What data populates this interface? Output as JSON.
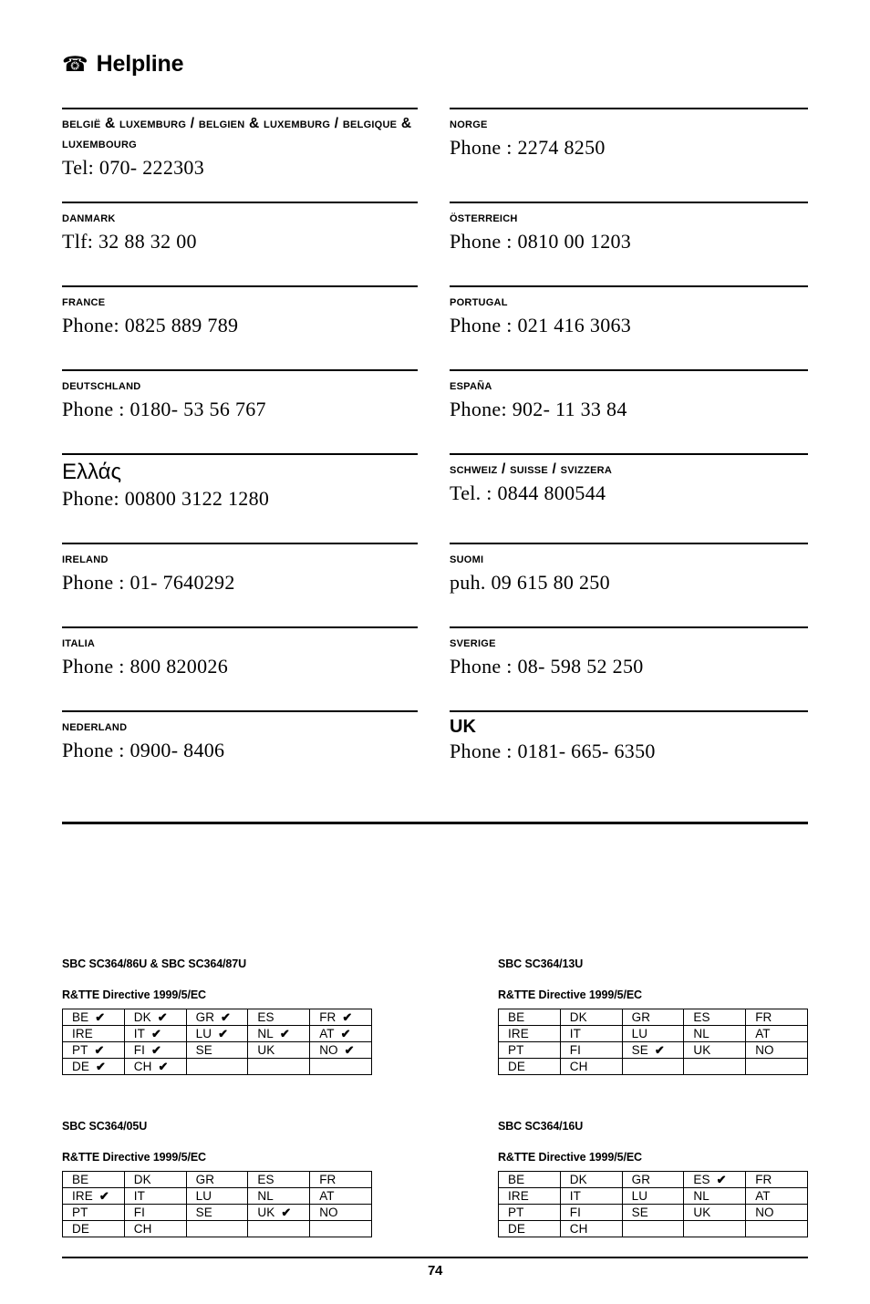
{
  "header": {
    "icon": "telephone-icon",
    "glyph": "☎",
    "title": "Helpline"
  },
  "helpline": {
    "left_column": [
      {
        "country": "België & Luxemburg / Belgien & Luxemburg / Belgique & Luxembourg",
        "phone": "Tel: 070- 222303",
        "style": "smallcaps"
      },
      {
        "country": "Danmark",
        "phone": "Tlf: 32 88 32 00",
        "style": "smallcaps"
      },
      {
        "country": "France",
        "phone": "Phone: 0825 889 789",
        "style": "smallcaps"
      },
      {
        "country": "Deutschland",
        "phone": "Phone : 0180- 53 56 767",
        "style": "smallcaps"
      },
      {
        "country": "Ελλάς",
        "phone": "Phone: 00800 3122 1280",
        "style": "greek"
      },
      {
        "country": "Ireland",
        "phone": "Phone : 01- 7640292",
        "style": "smallcaps"
      },
      {
        "country": "Italia",
        "phone": "Phone : 800 820026",
        "style": "smallcaps"
      },
      {
        "country": "Nederland",
        "phone": "Phone : 0900- 8406",
        "style": "smallcaps"
      }
    ],
    "right_column": [
      {
        "country": "Norge",
        "phone": "Phone : 2274 8250",
        "style": "smallcaps"
      },
      {
        "country": "Österreich",
        "phone": "Phone : 0810 00 1203",
        "style": "smallcaps"
      },
      {
        "country": "Portugal",
        "phone": "Phone : 021 416 3063",
        "style": "smallcaps"
      },
      {
        "country": "España",
        "phone": "Phone: 902- 11 33 84",
        "style": "smallcaps"
      },
      {
        "country": "Schweiz  / Suisse  / Svizzera",
        "phone": "Tel. : 0844 800544",
        "style": "smallcaps"
      },
      {
        "country": "Suomi",
        "phone": "puh. 09 615 80 250",
        "style": "smallcaps"
      },
      {
        "country": "Sverige",
        "phone": "Phone : 08- 598 52 250",
        "style": "smallcaps"
      },
      {
        "country": "UK",
        "phone": "Phone : 0181- 665- 6350",
        "style": "plain"
      }
    ]
  },
  "certifications": {
    "check_mark": "✔",
    "blocks": [
      {
        "model": "SBC SC364/86U & SBC SC364/87U",
        "directive": "R&TTE Directive  1999/5/EC",
        "rows": [
          [
            {
              "code": "BE",
              "checked": true
            },
            {
              "code": "DK",
              "checked": true
            },
            {
              "code": "GR",
              "checked": true
            },
            {
              "code": "ES",
              "checked": false
            },
            {
              "code": "FR",
              "checked": true
            }
          ],
          [
            {
              "code": "IRE",
              "checked": false
            },
            {
              "code": "IT",
              "checked": true
            },
            {
              "code": "LU",
              "checked": true
            },
            {
              "code": "NL",
              "checked": true
            },
            {
              "code": "AT",
              "checked": true
            }
          ],
          [
            {
              "code": "PT",
              "checked": true
            },
            {
              "code": "FI",
              "checked": true
            },
            {
              "code": "SE",
              "checked": false
            },
            {
              "code": "UK",
              "checked": false
            },
            {
              "code": "NO",
              "checked": true
            }
          ],
          [
            {
              "code": "DE",
              "checked": true
            },
            {
              "code": "CH",
              "checked": true
            },
            {
              "code": "",
              "checked": false
            },
            {
              "code": "",
              "checked": false
            },
            {
              "code": "",
              "checked": false
            }
          ]
        ]
      },
      {
        "model": "SBC SC364/13U",
        "directive": "R&TTE Directive  1999/5/EC",
        "rows": [
          [
            {
              "code": "BE",
              "checked": false
            },
            {
              "code": "DK",
              "checked": false
            },
            {
              "code": "GR",
              "checked": false
            },
            {
              "code": "ES",
              "checked": false
            },
            {
              "code": "FR",
              "checked": false
            }
          ],
          [
            {
              "code": "IRE",
              "checked": false
            },
            {
              "code": "IT",
              "checked": false
            },
            {
              "code": "LU",
              "checked": false
            },
            {
              "code": "NL",
              "checked": false
            },
            {
              "code": "AT",
              "checked": false
            }
          ],
          [
            {
              "code": "PT",
              "checked": false
            },
            {
              "code": "FI",
              "checked": false
            },
            {
              "code": "SE",
              "checked": true
            },
            {
              "code": "UK",
              "checked": false
            },
            {
              "code": "NO",
              "checked": false
            }
          ],
          [
            {
              "code": "DE",
              "checked": false
            },
            {
              "code": "CH",
              "checked": false
            },
            {
              "code": "",
              "checked": false
            },
            {
              "code": "",
              "checked": false
            },
            {
              "code": "",
              "checked": false
            }
          ]
        ]
      },
      {
        "model": "SBC SC364/05U",
        "directive": "R&TTE Directive  1999/5/EC",
        "rows": [
          [
            {
              "code": "BE",
              "checked": false
            },
            {
              "code": "DK",
              "checked": false
            },
            {
              "code": "GR",
              "checked": false
            },
            {
              "code": "ES",
              "checked": false
            },
            {
              "code": "FR",
              "checked": false
            }
          ],
          [
            {
              "code": "IRE",
              "checked": true
            },
            {
              "code": "IT",
              "checked": false
            },
            {
              "code": "LU",
              "checked": false
            },
            {
              "code": "NL",
              "checked": false
            },
            {
              "code": "AT",
              "checked": false
            }
          ],
          [
            {
              "code": "PT",
              "checked": false
            },
            {
              "code": "FI",
              "checked": false
            },
            {
              "code": "SE",
              "checked": false
            },
            {
              "code": "UK",
              "checked": true
            },
            {
              "code": "NO",
              "checked": false
            }
          ],
          [
            {
              "code": "DE",
              "checked": false
            },
            {
              "code": "CH",
              "checked": false
            },
            {
              "code": "",
              "checked": false
            },
            {
              "code": "",
              "checked": false
            },
            {
              "code": "",
              "checked": false
            }
          ]
        ]
      },
      {
        "model": "SBC SC364/16U",
        "directive": "R&TTE Directive  1999/5/EC",
        "rows": [
          [
            {
              "code": "BE",
              "checked": false
            },
            {
              "code": "DK",
              "checked": false
            },
            {
              "code": "GR",
              "checked": false
            },
            {
              "code": "ES",
              "checked": true
            },
            {
              "code": "FR",
              "checked": false
            }
          ],
          [
            {
              "code": "IRE",
              "checked": false
            },
            {
              "code": "IT",
              "checked": false
            },
            {
              "code": "LU",
              "checked": false
            },
            {
              "code": "NL",
              "checked": false
            },
            {
              "code": "AT",
              "checked": false
            }
          ],
          [
            {
              "code": "PT",
              "checked": false
            },
            {
              "code": "FI",
              "checked": false
            },
            {
              "code": "SE",
              "checked": false
            },
            {
              "code": "UK",
              "checked": false
            },
            {
              "code": "NO",
              "checked": false
            }
          ],
          [
            {
              "code": "DE",
              "checked": false
            },
            {
              "code": "CH",
              "checked": false
            },
            {
              "code": "",
              "checked": false
            },
            {
              "code": "",
              "checked": false
            },
            {
              "code": "",
              "checked": false
            }
          ]
        ]
      }
    ]
  },
  "footer": {
    "page_number": "74"
  }
}
